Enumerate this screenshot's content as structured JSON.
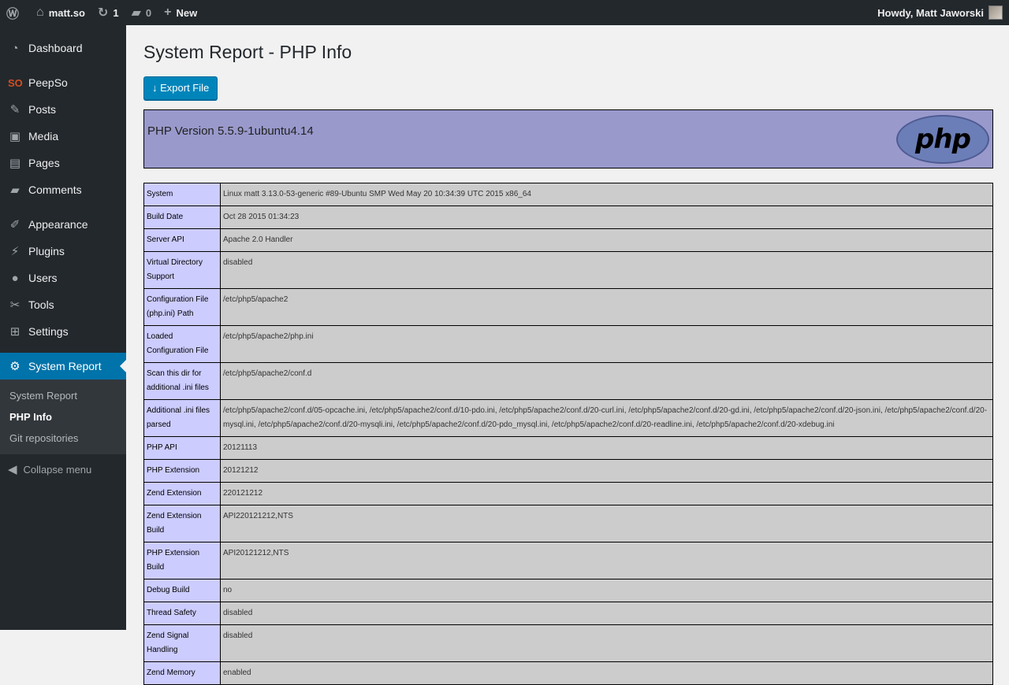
{
  "adminbar": {
    "site": "matt.so",
    "updates": "1",
    "comments": "0",
    "new": "New",
    "howdy": "Howdy, Matt Jaworski"
  },
  "sidebar": {
    "items": [
      {
        "label": "Dashboard",
        "icon": "dashboard-icon",
        "glyph": "◔"
      },
      {
        "label": "PeepSo",
        "icon": "peepso-icon",
        "glyph": "SO"
      },
      {
        "label": "Posts",
        "icon": "pin-icon",
        "glyph": "✎"
      },
      {
        "label": "Media",
        "icon": "media-icon",
        "glyph": "▣"
      },
      {
        "label": "Pages",
        "icon": "pages-icon",
        "glyph": "▤"
      },
      {
        "label": "Comments",
        "icon": "comment-icon",
        "glyph": "▰"
      },
      {
        "label": "Appearance",
        "icon": "brush-icon",
        "glyph": "✐"
      },
      {
        "label": "Plugins",
        "icon": "plugin-icon",
        "glyph": "⚡"
      },
      {
        "label": "Users",
        "icon": "user-icon",
        "glyph": "●"
      },
      {
        "label": "Tools",
        "icon": "wrench-icon",
        "glyph": "✂"
      },
      {
        "label": "Settings",
        "icon": "settings-icon",
        "glyph": "⊞"
      },
      {
        "label": "System Report",
        "icon": "gear-icon",
        "glyph": "⚙"
      }
    ],
    "submenu": [
      "System Report",
      "PHP Info",
      "Git repositories"
    ],
    "collapse": "Collapse menu"
  },
  "main": {
    "title": "System Report - PHP Info",
    "export": "↓ Export File",
    "php_version": "PHP Version 5.5.9-1ubuntu4.14",
    "logo": "php",
    "rows": [
      [
        "System",
        "Linux matt 3.13.0-53-generic #89-Ubuntu SMP Wed May 20 10:34:39 UTC 2015 x86_64"
      ],
      [
        "Build Date",
        "Oct 28 2015 01:34:23"
      ],
      [
        "Server API",
        "Apache 2.0 Handler"
      ],
      [
        "Virtual Directory Support",
        "disabled"
      ],
      [
        "Configuration File (php.ini) Path",
        "/etc/php5/apache2"
      ],
      [
        "Loaded Configuration File",
        "/etc/php5/apache2/php.ini"
      ],
      [
        "Scan this dir for additional .ini files",
        "/etc/php5/apache2/conf.d"
      ],
      [
        "Additional .ini files parsed",
        "/etc/php5/apache2/conf.d/05-opcache.ini, /etc/php5/apache2/conf.d/10-pdo.ini, /etc/php5/apache2/conf.d/20-curl.ini, /etc/php5/apache2/conf.d/20-gd.ini, /etc/php5/apache2/conf.d/20-json.ini, /etc/php5/apache2/conf.d/20-mysql.ini, /etc/php5/apache2/conf.d/20-mysqli.ini, /etc/php5/apache2/conf.d/20-pdo_mysql.ini, /etc/php5/apache2/conf.d/20-readline.ini, /etc/php5/apache2/conf.d/20-xdebug.ini"
      ],
      [
        "PHP API",
        "20121113"
      ],
      [
        "PHP Extension",
        "20121212"
      ],
      [
        "Zend Extension",
        "220121212"
      ],
      [
        "Zend Extension Build",
        "API220121212,NTS"
      ],
      [
        "PHP Extension Build",
        "API20121212,NTS"
      ],
      [
        "Debug Build",
        "no"
      ],
      [
        "Thread Safety",
        "disabled"
      ],
      [
        "Zend Signal Handling",
        "disabled"
      ],
      [
        "Zend Memory",
        "enabled"
      ]
    ]
  }
}
